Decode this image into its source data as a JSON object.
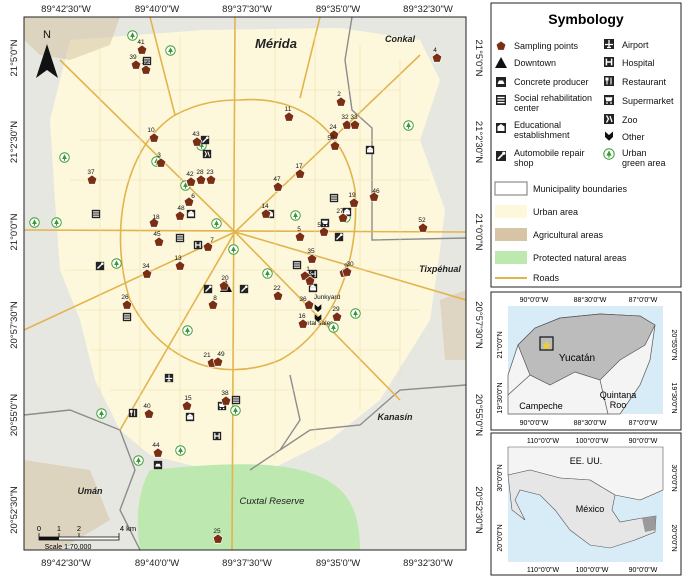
{
  "main_map": {
    "top_ticks": [
      "89°42'30\"W",
      "89°40'0\"W",
      "89°37'30\"W",
      "89°35'0\"W",
      "89°32'30\"W"
    ],
    "bottom_ticks": [
      "89°42'30\"W",
      "89°40'0\"W",
      "89°37'30\"W",
      "89°35'0\"W",
      "89°32'30\"W"
    ],
    "left_ticks": [
      "21°5'0\"N",
      "21°2'30\"N",
      "21°0'0\"N",
      "20°57'30\"N",
      "20°55'0\"N",
      "20°52'30\"N"
    ],
    "right_ticks": [
      "21°5'0\"N",
      "21°2'30\"N",
      "21°0'0\"N",
      "20°57'30\"N",
      "20°55'0\"N",
      "20°52'30\"N"
    ],
    "places": {
      "merida": "Mérida",
      "conkal": "Conkal",
      "tixpehual": "Tixpéhual",
      "kanasin": "Kanasín",
      "uman": "Umán",
      "cuxtal": "Cuxtal Reserve"
    },
    "annotations": {
      "junkyard": "Junkyard",
      "metal_sales": "Metal sales"
    },
    "north_label": "N",
    "scale": {
      "ticks": [
        "0",
        "1",
        "2",
        "4 km"
      ],
      "text": "Scale 1:70,000"
    },
    "sampling_points": [
      "1",
      "2",
      "3",
      "4",
      "5",
      "6",
      "7",
      "8",
      "9",
      "10",
      "11",
      "12",
      "13",
      "14",
      "15",
      "16",
      "17",
      "18",
      "19",
      "20",
      "21",
      "22",
      "23",
      "24",
      "25",
      "26",
      "27",
      "28",
      "29",
      "30",
      "31",
      "32",
      "33",
      "34",
      "35",
      "36",
      "37",
      "38",
      "39",
      "40",
      "41",
      "42",
      "43",
      "44",
      "45",
      "46",
      "47",
      "48",
      "49",
      "50",
      "51",
      "52"
    ]
  },
  "symbology": {
    "title": "Symbology",
    "items_left": [
      "Sampling points",
      "Downtown",
      "Concrete producer",
      "Social rehabilitation center",
      "Educational establishment",
      "Automobile repair shop"
    ],
    "items_right": [
      "Airport",
      "Hospital",
      "Restaurant",
      "Supermarket",
      "Zoo",
      "Other",
      "Urban green area"
    ],
    "areas": [
      "Municipality boundaries",
      "Urban area",
      "Agricultural areas",
      "Protected natural areas",
      "Roads"
    ]
  },
  "locator_yucatan": {
    "top_ticks": [
      "90°0'0\"W",
      "88°30'0\"W",
      "87°0'0\"W"
    ],
    "bottom_ticks": [
      "90°0'0\"W",
      "88°30'0\"W",
      "87°0'0\"W"
    ],
    "left_ticks": [
      "21°0'0\"N",
      "19°30'0\"N"
    ],
    "right_ticks": [
      "20°55'0\"N",
      "19°30'0\"N"
    ],
    "labels": {
      "yucatan": "Yucatán",
      "quintana_roo": "Quintana Roo",
      "campeche": "Campeche"
    }
  },
  "locator_mexico": {
    "top_ticks": [
      "110°0'0\"W",
      "100°0'0\"W",
      "90°0'0\"W"
    ],
    "bottom_ticks": [
      "110°0'0\"W",
      "100°0'0\"W",
      "90°0'0\"W"
    ],
    "left_ticks": [
      "30°0'0\"N",
      "20°0'0\"N"
    ],
    "right_ticks": [
      "30°0'0\"N",
      "20°0'0\"N"
    ],
    "labels": {
      "usa": "EE. UU.",
      "mexico": "México"
    }
  },
  "colors": {
    "sampling_point": "#7a2e12",
    "green_area": "#3a9a35",
    "urban_area": "#fdf8dc",
    "agricultural": "#d6c4a4",
    "protected": "#bde8b0",
    "roads": "#e2b44c",
    "boundary": "#8c8c8c"
  }
}
